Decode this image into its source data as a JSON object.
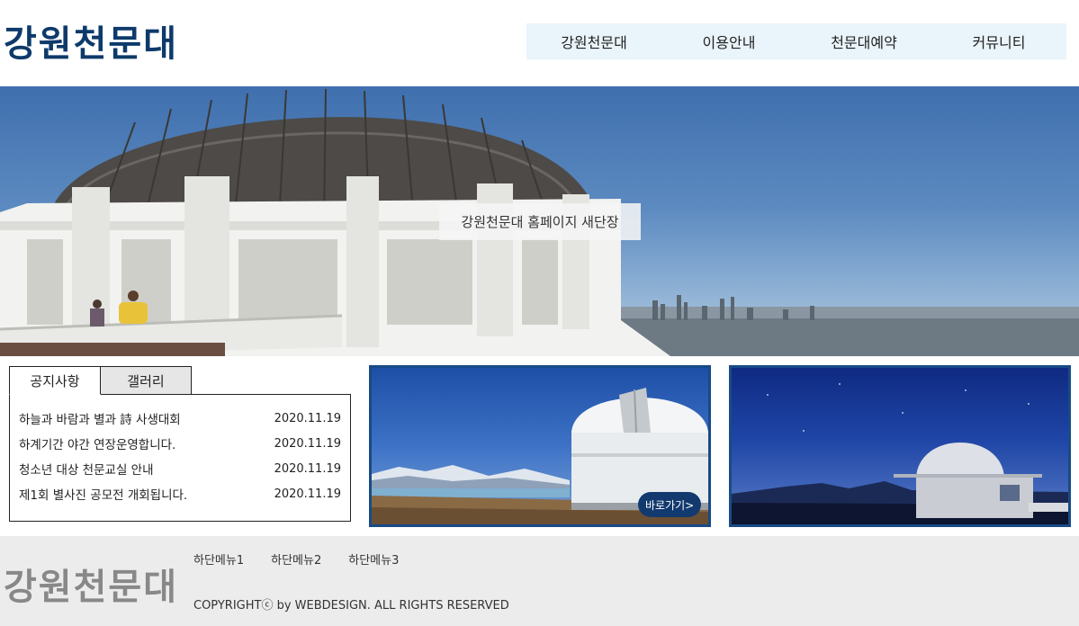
{
  "header": {
    "logo": "강원천문대",
    "nav": [
      "강원천문대",
      "이용안내",
      "천문대예약",
      "커뮤니티"
    ]
  },
  "hero": {
    "caption": "강원천문대 홈페이지 새단장"
  },
  "tabs": [
    "공지사항",
    "갤러리"
  ],
  "notices": [
    {
      "title": "하늘과 바람과 별과 詩 사생대회",
      "date": "2020.11.19"
    },
    {
      "title": "하계기간 야간 연장운영합니다.",
      "date": "2020.11.19"
    },
    {
      "title": "청소년 대상 천문교실 안내",
      "date": "2020.11.19"
    },
    {
      "title": "제1회 별사진 공모전 개회됩니다.",
      "date": "2020.11.19"
    }
  ],
  "gallery": {
    "go_label": "바로가기>"
  },
  "footer": {
    "logo": "강원천문대",
    "menu": [
      "하단메뉴1",
      "하단메뉴2",
      "하단메뉴3"
    ],
    "copyright": "COPYRIGHTⓒ by WEBDESIGN. ALL RIGHTS RESERVED"
  },
  "colors": {
    "brand": "#0d3a6a",
    "nav_bg": "#eaf4fb",
    "card_border": "#184b86",
    "footer_bg": "#ececec"
  }
}
